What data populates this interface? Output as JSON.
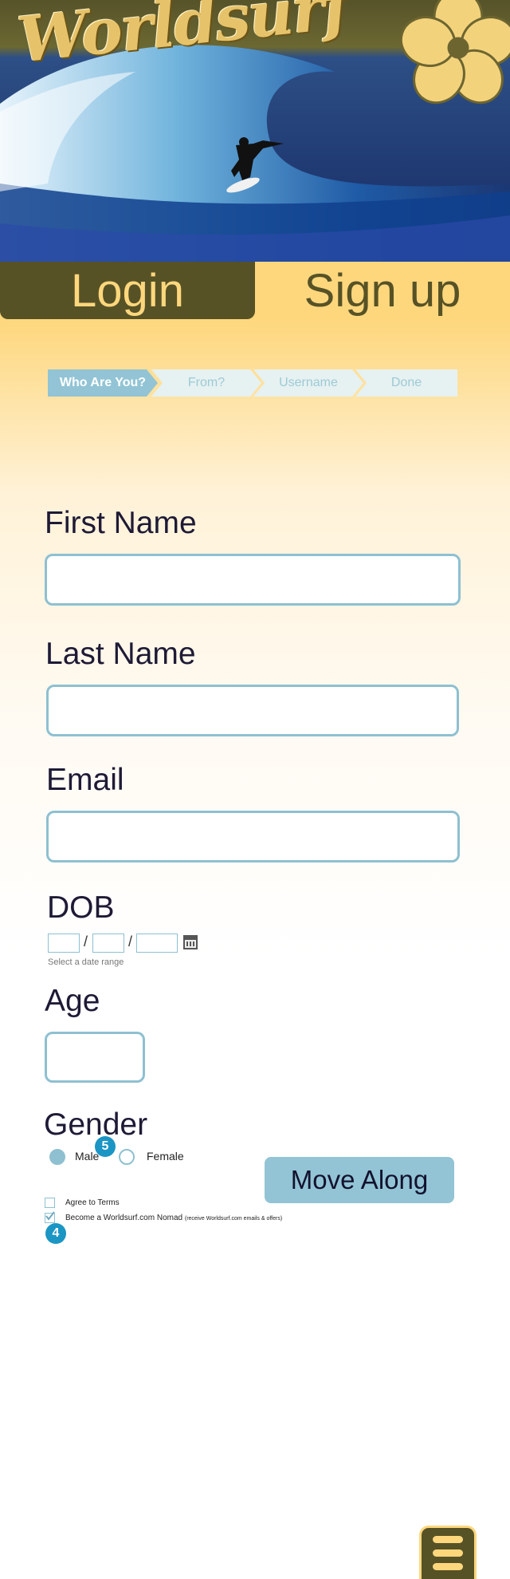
{
  "header": {
    "logo_text": "Worldsurf"
  },
  "tabs": {
    "login": "Login",
    "signup": "Sign up"
  },
  "steps": [
    "Who Are You?",
    "From?",
    "Username",
    "Done"
  ],
  "form": {
    "first_name_label": "First Name",
    "last_name_label": "Last Name",
    "email_label": "Email",
    "dob_label": "DOB",
    "dob_separator": "/",
    "dob_hint": "Select a date range",
    "age_label": "Age",
    "gender_label": "Gender",
    "gender_options": [
      "Male",
      "Female"
    ],
    "gender_selected": "Male",
    "submit_label": "Move Along",
    "agree_terms": "Agree to Terms",
    "nomad_label": "Become a Worldsurf.com Nomad",
    "nomad_note": "(receive Worldsurf.com emails & offers)"
  },
  "badges": {
    "gender": "5",
    "nomad": "4"
  },
  "colors": {
    "olive": "#575226",
    "sand": "#fed77d",
    "accent_blue": "#92c4d5",
    "badge_blue": "#1a95c4"
  }
}
